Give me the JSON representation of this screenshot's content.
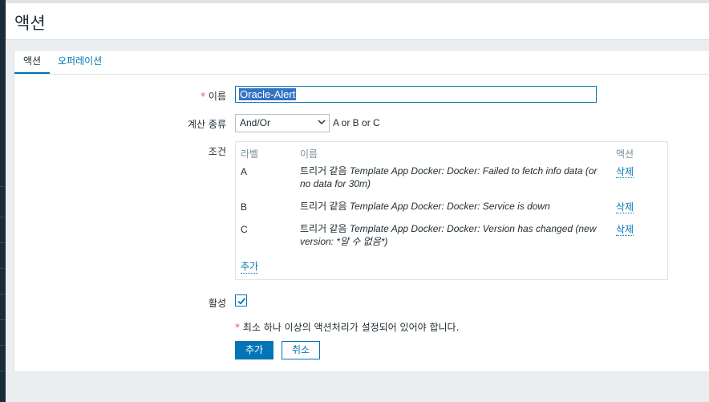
{
  "page": {
    "title": "액션"
  },
  "tabs": [
    {
      "label": "액션",
      "active": true
    },
    {
      "label": "오퍼레이션",
      "active": false
    }
  ],
  "form": {
    "name_label": "이름",
    "required_mark": "*",
    "name_value": "Oracle-Alert",
    "calc_type_label": "계산 종류",
    "calc_type_value": "And/Or",
    "calc_formula": "A or B or C",
    "conditions_label": "조건",
    "conditions": {
      "headers": {
        "label": "라벨",
        "name": "이름",
        "action": "액션"
      },
      "rows": [
        {
          "label": "A",
          "prefix": "트리거 같음",
          "detail": "Template App Docker: Docker: Failed to fetch info data (or no data for 30m)",
          "action": "삭제"
        },
        {
          "label": "B",
          "prefix": "트리거 같음",
          "detail": "Template App Docker: Docker: Service is down",
          "action": "삭제"
        },
        {
          "label": "C",
          "prefix": "트리거 같음",
          "detail": "Template App Docker: Docker: Version has changed (new version: *알 수 없음*)",
          "action": "삭제"
        }
      ],
      "add_label": "추가"
    },
    "enabled_label": "활성",
    "enabled": true,
    "notice": "최소 하나 이상의 액션처리가 설정되어 있어야 합니다.",
    "submit_label": "추가",
    "cancel_label": "취소"
  },
  "colors": {
    "accent": "#0275b8",
    "required": "#e45959",
    "sidebar": "#1a2c38"
  }
}
